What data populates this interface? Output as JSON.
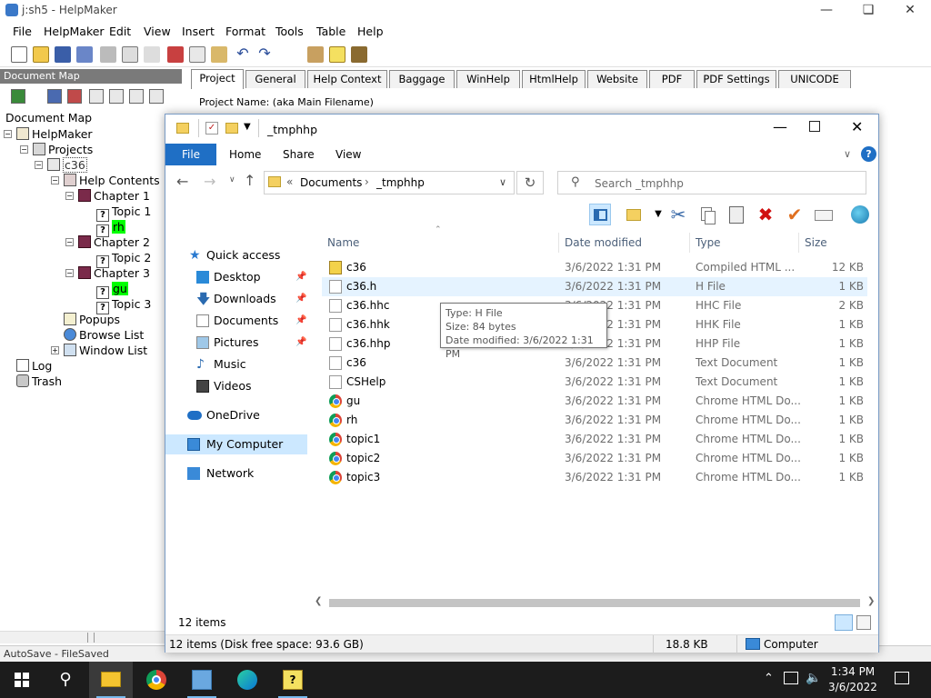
{
  "hm": {
    "title": "j:sh5 - HelpMaker",
    "menu": [
      "File",
      "HelpMaker",
      "Edit",
      "View",
      "Insert",
      "Format",
      "Tools",
      "Table",
      "Help"
    ],
    "docmap_header": "Document Map",
    "docmap_label": "Document Map",
    "tree": {
      "root": "HelpMaker",
      "projects": "Projects",
      "project": "c36",
      "help_contents": "Help Contents",
      "chapter1": "Chapter 1",
      "topic1": "Topic 1",
      "rh": "rh",
      "chapter2": "Chapter 2",
      "topic2": "Topic 2",
      "chapter3": "Chapter 3",
      "gu": "gu",
      "topic3": "Topic 3",
      "popups": "Popups",
      "browse_list": "Browse List",
      "window_list": "Window List",
      "log": "Log",
      "trash": "Trash"
    },
    "tabs": [
      "Project",
      "General",
      "Help Context",
      "Baggage",
      "WinHelp",
      "HtmlHelp",
      "Website",
      "PDF",
      "PDF Settings",
      "UNICODE"
    ],
    "project_name_label": "Project Name: (aka Main Filename)",
    "status_left": "AutoSave - FileSaved"
  },
  "explorer": {
    "title": "_tmphhp",
    "ribbon": {
      "file": "File",
      "home": "Home",
      "share": "Share",
      "view": "View"
    },
    "address": {
      "prefix": "«",
      "part1": "Documents",
      "sep": "›",
      "part2": "_tmphhp"
    },
    "search_placeholder": "Search _tmphhp",
    "nav": {
      "quick_access": "Quick access",
      "desktop": "Desktop",
      "downloads": "Downloads",
      "documents": "Documents",
      "pictures": "Pictures",
      "music": "Music",
      "videos": "Videos",
      "onedrive": "OneDrive",
      "my_computer": "My Computer",
      "network": "Network"
    },
    "columns": {
      "name": "Name",
      "date": "Date modified",
      "type": "Type",
      "size": "Size"
    },
    "files": [
      {
        "name": "c36",
        "date": "3/6/2022 1:31 PM",
        "type": "Compiled HTML ...",
        "size": "12 KB",
        "icon": "chm-icon"
      },
      {
        "name": "c36.h",
        "date": "3/6/2022 1:31 PM",
        "type": "H File",
        "size": "1 KB",
        "icon": "document-icon"
      },
      {
        "name": "c36.hhc",
        "date": "3/6/2022 1:31 PM",
        "type": "HHC File",
        "size": "2 KB",
        "icon": "document-icon"
      },
      {
        "name": "c36.hhk",
        "date": "3/6/2022 1:31 PM",
        "type": "HHK File",
        "size": "1 KB",
        "icon": "document-icon"
      },
      {
        "name": "c36.hhp",
        "date": "3/6/2022 1:31 PM",
        "type": "HHP File",
        "size": "1 KB",
        "icon": "document-icon"
      },
      {
        "name": "c36",
        "date": "3/6/2022 1:31 PM",
        "type": "Text Document",
        "size": "1 KB",
        "icon": "document-icon"
      },
      {
        "name": "CSHelp",
        "date": "3/6/2022 1:31 PM",
        "type": "Text Document",
        "size": "1 KB",
        "icon": "document-icon"
      },
      {
        "name": "gu",
        "date": "3/6/2022 1:31 PM",
        "type": "Chrome HTML Do...",
        "size": "1 KB",
        "icon": "chrome-icon"
      },
      {
        "name": "rh",
        "date": "3/6/2022 1:31 PM",
        "type": "Chrome HTML Do...",
        "size": "1 KB",
        "icon": "chrome-icon"
      },
      {
        "name": "topic1",
        "date": "3/6/2022 1:31 PM",
        "type": "Chrome HTML Do...",
        "size": "1 KB",
        "icon": "chrome-icon"
      },
      {
        "name": "topic2",
        "date": "3/6/2022 1:31 PM",
        "type": "Chrome HTML Do...",
        "size": "1 KB",
        "icon": "chrome-icon"
      },
      {
        "name": "topic3",
        "date": "3/6/2022 1:31 PM",
        "type": "Chrome HTML Do...",
        "size": "1 KB",
        "icon": "chrome-icon"
      }
    ],
    "tooltip": {
      "line1": "Type: H File",
      "line2": "Size: 84 bytes",
      "line3": "Date modified: 3/6/2022 1:31 PM"
    },
    "item_count": "12 items",
    "bottom_status": "12 items (Disk free space: 93.6 GB)",
    "bottom_size": "18.8 KB",
    "bottom_location": "Computer"
  },
  "taskbar": {
    "time": "1:34 PM",
    "date": "3/6/2022"
  },
  "colors": {
    "accent": "#1f6fc5",
    "selection": "#cce8ff",
    "highlight": "#00ff00"
  }
}
